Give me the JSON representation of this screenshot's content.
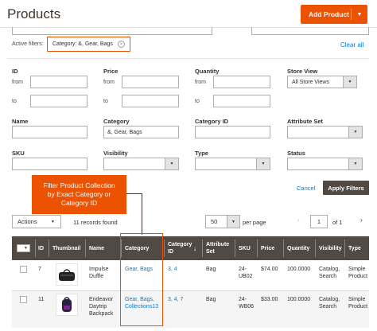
{
  "header": {
    "title": "Products",
    "add_button": "Add Product",
    "add_caret": "▼"
  },
  "filters": {
    "active_label": "Active filters:",
    "chip": "Category: &, Gear, Bags",
    "chip_remove": "×",
    "clear_all": "Clear all",
    "id": {
      "label": "ID",
      "from": "from",
      "to": "to"
    },
    "price": {
      "label": "Price",
      "from": "from",
      "to": "to"
    },
    "quantity": {
      "label": "Quantity",
      "from": "from",
      "to": "to"
    },
    "store_view": {
      "label": "Store View",
      "value": "All Store Views"
    },
    "name": {
      "label": "Name",
      "value": ""
    },
    "category": {
      "label": "Category",
      "value": "&, Gear, Bags"
    },
    "category_id": {
      "label": "Category ID",
      "value": ""
    },
    "attribute_set": {
      "label": "Attribute Set",
      "value": ""
    },
    "sku": {
      "label": "SKU",
      "value": ""
    },
    "visibility": {
      "label": "Visibility",
      "value": ""
    },
    "type": {
      "label": "Type",
      "value": ""
    },
    "status": {
      "label": "Status",
      "value": ""
    },
    "cancel": "Cancel",
    "apply": "Apply Filters"
  },
  "callout": {
    "line1": "Filter Product Collection",
    "line2": "by Exact Category or",
    "line3": "Category ID"
  },
  "toolbar": {
    "actions": "Actions",
    "records": "11 records found",
    "per_page_value": "50",
    "per_page_label": "per page",
    "page": "1",
    "of": "of 1",
    "prev": "‹",
    "next": "›"
  },
  "grid": {
    "columns": [
      "ID",
      "Thumbnail",
      "Name",
      "Category",
      "Category ID",
      "Attribute Set",
      "SKU",
      "Price",
      "Quantity",
      "Visibility",
      "Type"
    ],
    "sort_arrow": "↓",
    "rows": [
      {
        "id": "7",
        "name1": "Impulse",
        "name2": "Duffle",
        "name3": "",
        "cat1": "Gear, Bags",
        "cat2": "",
        "catid": "3, 4",
        "attr": "Bag",
        "sku1": "24-",
        "sku2": "UB02",
        "price": "$74.00",
        "qty": "100.0000",
        "vis1": "Catalog,",
        "vis2": "Search",
        "type1": "Simple",
        "type2": "Product"
      },
      {
        "id": "11",
        "name1": "Endeavor",
        "name2": "Daytrip",
        "name3": "Backpack",
        "cat1": "Gear, Bags,",
        "cat2": "Collections13",
        "catid": "3, 4, 7",
        "attr": "Bag",
        "sku1": "24-",
        "sku2": "WB06",
        "price": "$33.00",
        "qty": "100.0000",
        "vis1": "Catalog,",
        "vis2": "Search",
        "type1": "Simple",
        "type2": "Product"
      }
    ]
  },
  "colors": {
    "accent": "#eb5202",
    "header_bg": "#514943",
    "link": "#007bdb"
  },
  "icons": {
    "thumb1": "duffle-bag-icon",
    "thumb2": "backpack-icon"
  }
}
